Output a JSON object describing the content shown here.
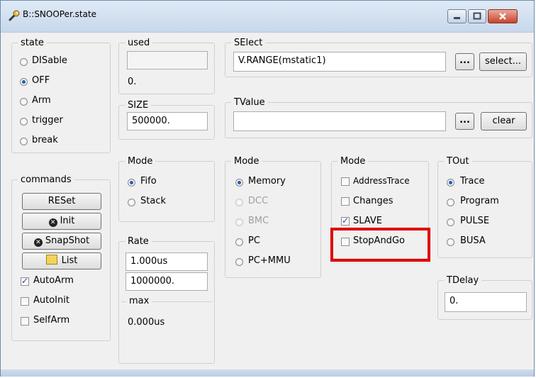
{
  "window": {
    "title": "B::SNOOPer.state",
    "icon": "wrench-icon",
    "controls": [
      "minimize-icon",
      "maximize-icon",
      "close-icon"
    ]
  },
  "state": {
    "legend": "state",
    "options": [
      {
        "label": "DISable",
        "checked": false
      },
      {
        "label": "OFF",
        "checked": true
      },
      {
        "label": "Arm",
        "checked": false
      },
      {
        "label": "trigger",
        "checked": false
      },
      {
        "label": "break",
        "checked": false
      }
    ]
  },
  "used": {
    "legend": "used",
    "value": "",
    "count": "0."
  },
  "size": {
    "legend": "SIZE",
    "value": "500000."
  },
  "select": {
    "legend": "SElect",
    "value": "V.RANGE(mstatic1)",
    "dots_label": "...",
    "button_label": "select..."
  },
  "tvalue": {
    "legend": "TValue",
    "value": "",
    "dots_label": "...",
    "button_label": "clear"
  },
  "commands": {
    "legend": "commands",
    "buttons": [
      {
        "label": "RESet",
        "icon": ""
      },
      {
        "label": "Init",
        "icon": "record-icon"
      },
      {
        "label": "SnapShot",
        "icon": "snapshot-icon"
      },
      {
        "label": "List",
        "icon": "list-icon"
      }
    ],
    "checks": [
      {
        "label": "AutoArm",
        "checked": true
      },
      {
        "label": "AutoInit",
        "checked": false
      },
      {
        "label": "SelfArm",
        "checked": false
      }
    ]
  },
  "mode_fifo": {
    "legend": "Mode",
    "options": [
      {
        "label": "Fifo",
        "checked": true
      },
      {
        "label": "Stack",
        "checked": false
      }
    ]
  },
  "rate": {
    "legend": "Rate",
    "value1": "1.000us",
    "value2": "1000000.",
    "max_legend": "max",
    "max_value": "0.000us"
  },
  "mode_memory": {
    "legend": "Mode",
    "options": [
      {
        "label": "Memory",
        "checked": true,
        "disabled": false
      },
      {
        "label": "DCC",
        "checked": false,
        "disabled": true
      },
      {
        "label": "BMC",
        "checked": false,
        "disabled": true
      },
      {
        "label": "PC",
        "checked": false,
        "disabled": false
      },
      {
        "label": "PC+MMU",
        "checked": false,
        "disabled": false
      }
    ]
  },
  "mode_flags": {
    "legend": "Mode",
    "options": [
      {
        "label": "AddressTrace",
        "checked": false
      },
      {
        "label": "Changes",
        "checked": false
      },
      {
        "label": "SLAVE",
        "checked": true
      },
      {
        "label": "StopAndGo",
        "checked": false
      }
    ]
  },
  "tout": {
    "legend": "TOut",
    "options": [
      {
        "label": "Trace",
        "checked": true
      },
      {
        "label": "Program",
        "checked": false
      },
      {
        "label": "PULSE",
        "checked": false
      },
      {
        "label": "BUSA",
        "checked": false
      }
    ]
  },
  "tdelay": {
    "legend": "TDelay",
    "value": "0."
  },
  "colors": {
    "highlight": "#e00000",
    "accent": "#1f5fb8"
  }
}
